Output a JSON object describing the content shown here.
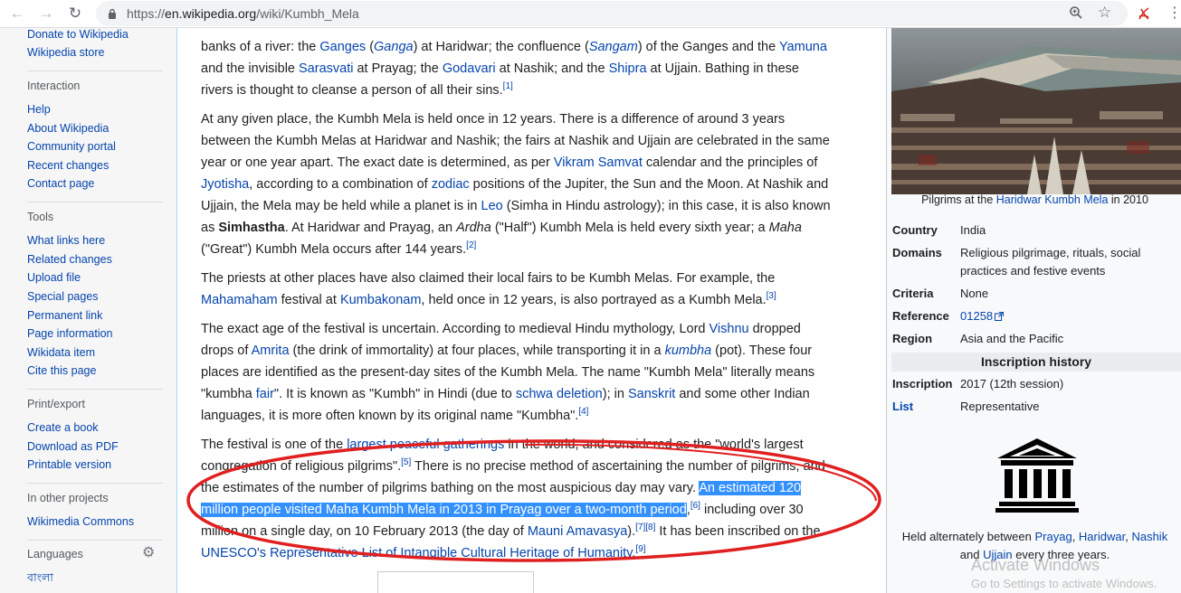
{
  "browser": {
    "url_prefix": "https://",
    "url_host": "en.wikipedia.org",
    "url_path": "/wiki/Kumbh_Mela"
  },
  "sidebar": {
    "top_links": [
      "Donate to Wikipedia",
      "Wikipedia store"
    ],
    "interaction": {
      "heading": "Interaction",
      "items": [
        "Help",
        "About Wikipedia",
        "Community portal",
        "Recent changes",
        "Contact page"
      ]
    },
    "tools": {
      "heading": "Tools",
      "items": [
        "What links here",
        "Related changes",
        "Upload file",
        "Special pages",
        "Permanent link",
        "Page information",
        "Wikidata item",
        "Cite this page"
      ]
    },
    "print": {
      "heading": "Print/export",
      "items": [
        "Create a book",
        "Download as PDF",
        "Printable version"
      ]
    },
    "projects": {
      "heading": "In other projects",
      "items": [
        "Wikimedia Commons"
      ]
    },
    "languages": {
      "heading": "Languages",
      "items": [
        "বাংলা"
      ]
    }
  },
  "article": {
    "p1": {
      "l1_a": "banks of a river: the ",
      "l1_ganges": "Ganges",
      "l1_b": " (",
      "l1_ganga": "Ganga",
      "l1_c": ") at Haridwar; the confluence (",
      "l1_sangam": "Sangam",
      "l1_d": ") of the Ganges and the ",
      "l1_yamuna": "Yamuna",
      "l2_a": "and the invisible ",
      "l2_sarasvati": "Sarasvati",
      "l2_b": " at Prayag; the ",
      "l2_godavari": "Godavari",
      "l2_c": " at Nashik; and the ",
      "l2_shipra": "Shipra",
      "l2_d": " at Ujjain. Bathing in these",
      "l3_a": "rivers is thought to cleanse a person of all their sins.",
      "l3_ref": "[1]"
    },
    "p2": {
      "l1": "At any given place, the Kumbh Mela is held once in 12 years. There is a difference of around 3 years",
      "l2": "between the Kumbh Melas at Haridwar and Nashik; the fairs at Nashik and Ujjain are celebrated in the same",
      "l3_a": "year or one year apart. The exact date is determined, as per ",
      "l3_vikram": "Vikram Samvat",
      "l3_b": " calendar and the principles of",
      "l4_jyotisha": "Jyotisha",
      "l4_a": ", according to a combination of ",
      "l4_zodiac": "zodiac",
      "l4_b": " positions of the Jupiter, the Sun and the Moon. At Nashik and",
      "l5_a": "Ujjain, the Mela may be held while a planet is in ",
      "l5_leo": "Leo",
      "l5_b": " (Simha in Hindu astrology); in this case, it is also known",
      "l6_a": "as ",
      "l6_simhastha": "Simhastha",
      "l6_b": ". At Haridwar and Prayag, an ",
      "l6_ardha": "Ardha",
      "l6_c": " (\"Half\") Kumbh Mela is held every sixth year; a ",
      "l6_maha": "Maha",
      "l7_a": "(\"Great\") Kumbh Mela occurs after 144 years.",
      "l7_ref": "[2]"
    },
    "p3": {
      "l1": "The priests at other places have also claimed their local fairs to be Kumbh Melas. For example, the",
      "l2_mahamaham": "Mahamaham",
      "l2_a": " festival at ",
      "l2_kumbakonam": "Kumbakonam",
      "l2_b": ", held once in 12 years, is also portrayed as a Kumbh Mela.",
      "l2_ref": "[3]"
    },
    "p4": {
      "l1_a": "The exact age of the festival is uncertain. According to medieval Hindu mythology, Lord ",
      "l1_vishnu": "Vishnu",
      "l1_b": " dropped",
      "l2_a": "drops of ",
      "l2_amrita": "Amrita",
      "l2_b": " (the drink of immortality) at four places, while transporting it in a ",
      "l2_kumbha": "kumbha",
      "l2_c": " (pot). These four",
      "l3": "places are identified as the present-day sites of the Kumbh Mela. The name \"Kumbh Mela\" literally means",
      "l4_a": "\"kumbha ",
      "l4_fair": "fair",
      "l4_b": "\". It is known as \"Kumbh\" in Hindi (due to ",
      "l4_schwa": "schwa deletion",
      "l4_c": "); in ",
      "l4_sanskrit": "Sanskrit",
      "l4_d": " and some other Indian",
      "l5_a": "languages, it is more often known by its original name \"Kumbha\".",
      "l5_ref": "[4]"
    },
    "p5": {
      "l1_a": "The festival is one of the ",
      "l1_largest": "largest peaceful gatherings",
      "l1_b": " in the world, and considered as the \"world's largest",
      "l2_a": "congregation of religious pilgrims\".",
      "l2_ref": "[5]",
      "l2_b": " There is no precise method of ascertaining the number of pilgrims, and",
      "l3_a": "the estimates of the number of pilgrims bathing on the most auspicious day may vary. ",
      "l3_hl": "An estimated 120",
      "l4_hl": "million people visited Maha Kumbh Mela in 2013 in Prayag over a two-month period",
      "l4_a": ",",
      "l4_ref": "[6]",
      "l4_b": " including over 30",
      "l5_a": "million on a single day, on 10 February 2013 (the day of ",
      "l5_mauni": "Mauni Amavasya",
      "l5_b": ").",
      "l5_ref": "[7][8]",
      "l5_c": " It has been inscribed on the",
      "l6_unesco": "UNESCO's Representative List of Intangible Cultural Heritage of Humanity",
      "l6_a": ".",
      "l6_ref": "[9]"
    }
  },
  "infobox": {
    "caption_a": "Pilgrims at the ",
    "caption_link": "Haridwar Kumbh Mela",
    "caption_b": " in 2010",
    "rows": [
      {
        "label": "Country",
        "value": "India",
        "link": true
      },
      {
        "label": "Domains",
        "value": "Religious pilgrimage, rituals, social practices and festive events",
        "link": false
      },
      {
        "label": "Criteria",
        "value": "None",
        "link": false
      },
      {
        "label": "Reference",
        "value": "01258",
        "link": true
      },
      {
        "label": "Region",
        "value": "Asia and the Pacific",
        "link": true
      }
    ],
    "history_heading": "Inscription history",
    "history_rows": [
      {
        "label": "Inscription",
        "value": "2017 (12th session)"
      },
      {
        "label": "List",
        "value": "Representative"
      }
    ],
    "footer_a": "Held alternately between ",
    "footer_prayag": "Prayag",
    "footer_sep1": ", ",
    "footer_haridwar": "Haridwar",
    "footer_sep2": ", ",
    "footer_nashik": "Nashik",
    "footer_b": " and ",
    "footer_ujjain": "Ujjain",
    "footer_c": " every three years."
  },
  "watermark": {
    "title": "Activate Windows",
    "subtitle": "Go to Settings to activate Windows."
  },
  "colors": {
    "link": "#0645ad",
    "highlight": "#3390ff",
    "annotation": "#e02020"
  }
}
